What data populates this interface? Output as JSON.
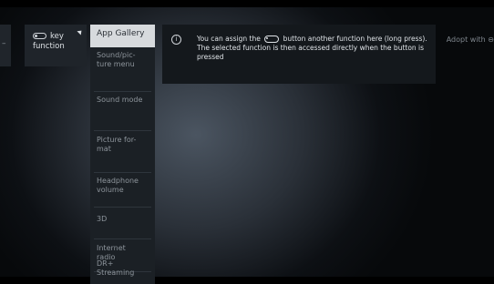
{
  "edge_stub": {
    "label": "–"
  },
  "key_tile": {
    "icon": "toggle-button-icon",
    "line1": "key",
    "line2": "function"
  },
  "menu": {
    "items": [
      {
        "label": "App Gallery",
        "selected": true
      },
      {
        "label": "Sound/pic-ture menu"
      },
      {
        "label": "Sound mode"
      },
      {
        "label": "Picture for-mat"
      },
      {
        "label": "Headphone volume"
      },
      {
        "label": "3D"
      },
      {
        "label": "Internet radio"
      },
      {
        "label": "DR+ Streaming"
      }
    ]
  },
  "info": {
    "icon": "info-icon",
    "text_before": "You can assign the",
    "text_after": "button another function here (long press). The selected function is then accessed directly when the button is pressed"
  },
  "adopt": {
    "label": "Adopt with"
  }
}
